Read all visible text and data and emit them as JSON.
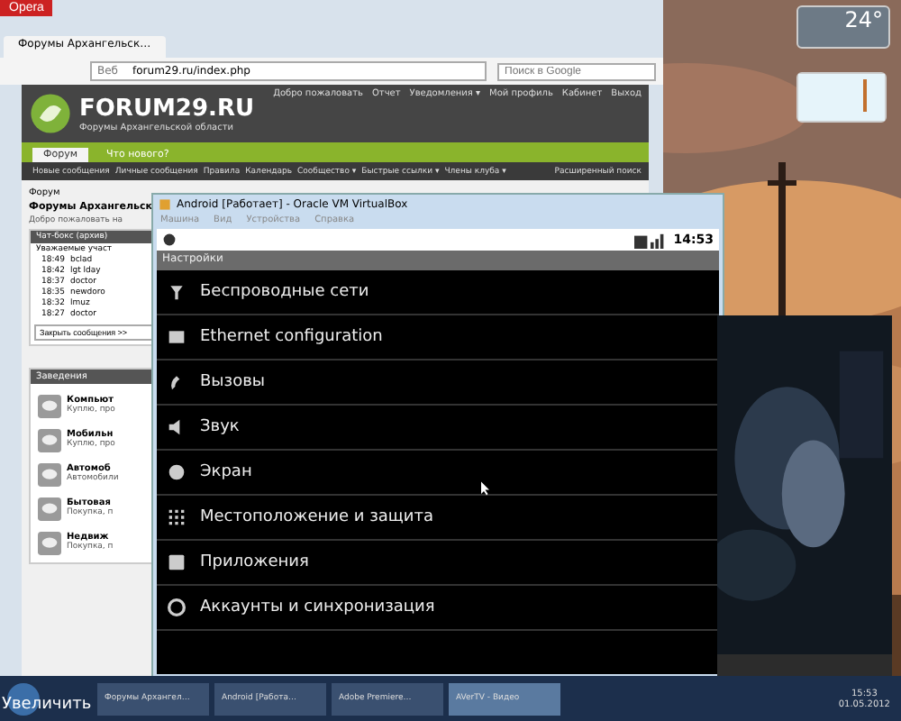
{
  "browser": {
    "menu_button": "Opera",
    "tab_title": "Форумы Архангельск…",
    "address_prefix": "Веб",
    "address": "forum29.ru/index.php",
    "search_placeholder": "Поиск в Google",
    "site": {
      "logo": "FORUM29.RU",
      "tagline": "Форумы Архангельской области",
      "top_links": [
        "Добро пожаловать",
        "Отчет",
        "Уведомления ▾",
        "Мой профиль",
        "Кабинет",
        "Выход"
      ],
      "tabs": [
        {
          "label": "Форум",
          "selected": true
        },
        {
          "label": "Что нового?",
          "selected": false
        }
      ],
      "nav_links": [
        "Новые сообщения",
        "Личные сообщения",
        "Правила",
        "Календарь",
        "Сообщество ▾",
        "Быстрые ссылки ▾",
        "Члены клуба ▾"
      ],
      "advanced_search": "Расширенный поиск",
      "breadcrumb": "Форум",
      "heading": "Форумы Архангельск",
      "subheading": "Добро пожаловать на",
      "chat": {
        "title": "Чат-бокс (архив)",
        "notice": "Уважаемые участ",
        "send_button": "Закрыть сообщения >>",
        "messages": [
          {
            "time": "18:49",
            "user": "bclad"
          },
          {
            "time": "18:42",
            "user": "lgt lday"
          },
          {
            "time": "18:37",
            "user": "doctor"
          },
          {
            "time": "18:35",
            "user": "newdoro"
          },
          {
            "time": "18:32",
            "user": "lmuz"
          },
          {
            "time": "18:27",
            "user": "doctor"
          }
        ]
      },
      "section_title": "Заведения",
      "forums": [
        {
          "title": "Компьют",
          "desc": "Куплю, про"
        },
        {
          "title": "Мобильн",
          "desc": "Куплю, про"
        },
        {
          "title": "Автомоб",
          "desc": "Автомобили"
        },
        {
          "title": "Бытовая",
          "desc": "Покупка, п"
        },
        {
          "title": "Недвиж",
          "desc": "Покупка, п"
        }
      ]
    }
  },
  "vm": {
    "title": "Android [Работает] - Oracle VM VirtualBox",
    "menu": [
      "Машина",
      "Вид",
      "Устройства",
      "Справка"
    ],
    "clock": "14:53",
    "screen_title": "Настройки",
    "items": [
      "Беспроводные сети",
      "Ethernet configuration",
      "Вызовы",
      "Звук",
      "Экран",
      "Местоположение и защита",
      "Приложения",
      "Аккаунты и синхронизация"
    ]
  },
  "weather": {
    "temperature": "24°"
  },
  "tooltip": "Увеличить",
  "taskbar": {
    "tasks": [
      {
        "label": "Форумы Архангел…",
        "selected": false
      },
      {
        "label": "Android [Работа…",
        "selected": false
      },
      {
        "label": "Adobe Premiere…",
        "selected": false
      },
      {
        "label": "AVerTV - Видео",
        "selected": true
      }
    ],
    "time": "15:53",
    "date": "01.05.2012"
  }
}
